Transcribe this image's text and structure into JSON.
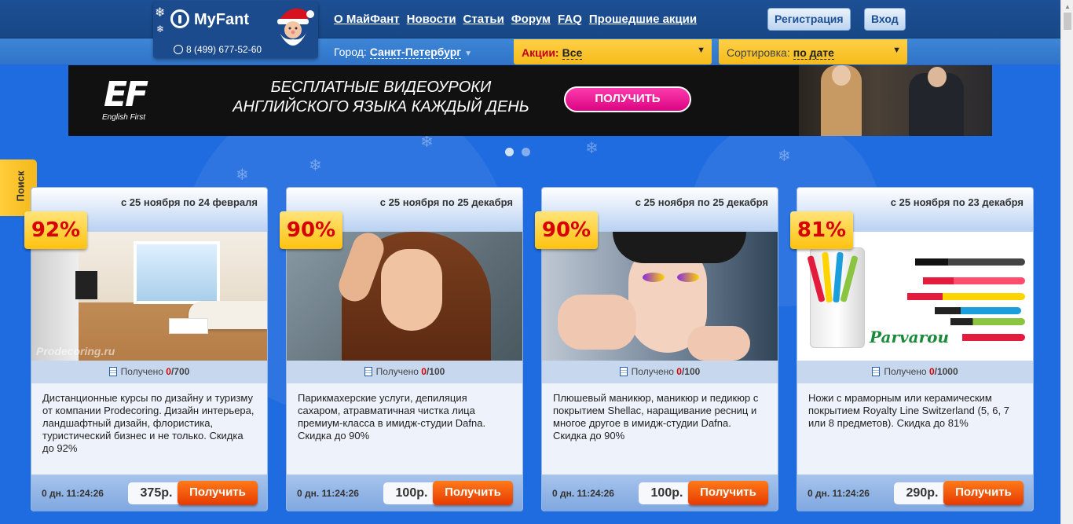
{
  "header": {
    "logo_text": "MyFant",
    "phone": "8 (499) 677-52-60",
    "nav": [
      "О МайФант",
      "Новости",
      "Статьи",
      "Форум",
      "FAQ",
      "Прошедшие акции"
    ],
    "register_label": "Регистрация",
    "login_label": "Вход",
    "city_label": "Город:",
    "city_value": "Санкт-Петербург",
    "deals_label": "Акции:",
    "deals_value": "Все",
    "sort_label": "Сортировка:",
    "sort_value": "по дате"
  },
  "banner": {
    "logo": "EF",
    "logo_sub": "English First",
    "headline_line1": "БЕСПЛАТНЫЕ ВИДЕОУРОКИ",
    "headline_line2": "АНГЛИЙСКОГО ЯЗЫКА КАЖДЫЙ ДЕНЬ",
    "cta_label": "ПОЛУЧИТЬ"
  },
  "search_tab_label": "Поиск",
  "deals": [
    {
      "period": "с 25 ноября по 24 февраля",
      "discount": "92%",
      "received_label": "Получено",
      "received": "0",
      "total": "/700",
      "description": "Дистанционные курсы по дизайну и туризму от компании Prodecoring. Дизайн интерьера, ландшафтный дизайн, флористика, туристический бизнес и не только. Скидка до 92%",
      "timer": "0 дн. 11:24:26",
      "price": "375р.",
      "button_label": "Получить",
      "watermark": "Prodecoring.ru"
    },
    {
      "period": "с 25 ноября по 25 декабря",
      "discount": "90%",
      "received_label": "Получено",
      "received": "0",
      "total": "/100",
      "description": "Парикмахерские услуги, депиляция сахаром, атравматичная чистка лица премиум-класса в имидж-студии Dafna. Скидка до 90%",
      "timer": "0 дн. 11:24:26",
      "price": "100р.",
      "button_label": "Получить"
    },
    {
      "period": "с 25 ноября по 25 декабря",
      "discount": "90%",
      "received_label": "Получено",
      "received": "0",
      "total": "/100",
      "description": "Плюшевый маникюр, маникюр и педикюр с покрытием Shellac, наращивание ресниц и многое другое в имидж-студии Dafna. Скидка до 90%",
      "timer": "0 дн. 11:24:26",
      "price": "100р.",
      "button_label": "Получить"
    },
    {
      "period": "с 25 ноября по 23 декабря",
      "discount": "81%",
      "received_label": "Получено",
      "received": "0",
      "total": "/1000",
      "description": "Ножи с мраморным или керамическим покрытием Royalty Line Switzerland (5, 6, 7 или 8 предметов). Скидка до 81%",
      "timer": "0 дн. 11:24:26",
      "price": "290р.",
      "button_label": "Получить",
      "brand": "Parvarou"
    }
  ]
}
